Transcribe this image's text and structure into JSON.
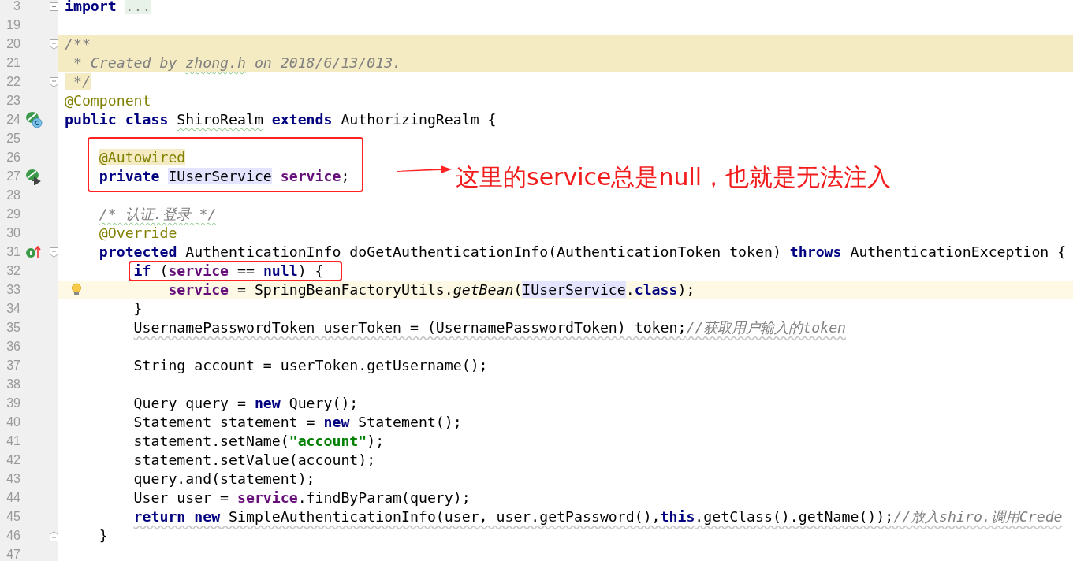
{
  "editor": {
    "lines": [
      {
        "number": "3",
        "fold": {
          "kind": "folded"
        },
        "tokens": [
          {
            "t": "import ",
            "kind": "keyword"
          },
          {
            "t": "...",
            "kind": "folded"
          }
        ]
      },
      {
        "number": "19"
      },
      {
        "number": "20",
        "fold": {
          "kind": "start"
        },
        "doc_block": true,
        "tokens": [
          {
            "t": "/**",
            "kind": "doc"
          }
        ]
      },
      {
        "number": "21",
        "doc_block": true,
        "tokens": [
          {
            "t": " * Created by ",
            "kind": "doc"
          },
          {
            "t": "zhong.h",
            "kind": "doc",
            "typo": true
          },
          {
            "t": " on 2018/6/13/013.",
            "kind": "doc"
          }
        ]
      },
      {
        "number": "22",
        "fold": {
          "kind": "start"
        },
        "tokens": [
          {
            "t": " */",
            "kind": "doc",
            "highlighted": true
          }
        ]
      },
      {
        "number": "23",
        "tokens": [
          {
            "t": "@Component",
            "kind": "annotation"
          }
        ]
      },
      {
        "number": "24",
        "gutter": {
          "kind": "bean_class"
        },
        "tokens": [
          {
            "t": "public class ",
            "kind": "keyword"
          },
          {
            "t": "ShiroRealm",
            "kind": "plain",
            "typo": true
          },
          {
            "t": " extends",
            "kind": "keyword"
          },
          {
            "t": " AuthorizingRealm {",
            "kind": "plain"
          }
        ],
        "children": [
          {
            "number": "25"
          },
          {
            "number": "26",
            "tokens": [
              {
                "t": "@Autowired",
                "kind": "annotation",
                "highlighted": true
              }
            ]
          },
          {
            "number": "27",
            "gutter": {
              "kind": "bean_inject"
            },
            "tokens": [
              {
                "t": "private ",
                "kind": "keyword"
              },
              {
                "t": "IUserService",
                "kind": "plain",
                "highlighted": true
              },
              {
                "t": " service",
                "kind": "field"
              },
              {
                "t": ";",
                "kind": "plain"
              }
            ]
          },
          {
            "number": "28"
          },
          {
            "number": "29",
            "tokens": [
              {
                "t": "/* 认证.登录 */",
                "kind": "comment",
                "typo": true
              }
            ]
          },
          {
            "number": "30",
            "tokens": [
              {
                "t": "@Override",
                "kind": "annotation"
              }
            ]
          },
          {
            "number": "31",
            "gutter": {
              "kind": "override"
            },
            "fold": {
              "kind": "start"
            },
            "tokens": [
              {
                "t": "protected",
                "kind": "keyword"
              },
              {
                "t": " AuthenticationInfo doGetAuthenticationInfo(AuthenticationToken token) ",
                "kind": "plain"
              },
              {
                "t": "throws",
                "kind": "keyword"
              },
              {
                "t": " AuthenticationException {",
                "kind": "plain"
              }
            ],
            "children": [
              {
                "number": "32",
                "outlined": true,
                "tokens": [
                  {
                    "t": "if",
                    "kind": "keyword"
                  },
                  {
                    "t": " (",
                    "kind": "plain"
                  },
                  {
                    "t": "service",
                    "kind": "field"
                  },
                  {
                    "t": " == ",
                    "kind": "plain"
                  },
                  {
                    "t": "null",
                    "kind": "keyword"
                  },
                  {
                    "t": ") {",
                    "kind": "plain"
                  }
                ],
                "children": [
                  {
                    "number": "33",
                    "caret_line": true,
                    "intention": true,
                    "tokens": [
                      {
                        "t": "service",
                        "kind": "field"
                      },
                      {
                        "t": " = SpringBeanFactoryUtils.",
                        "kind": "plain"
                      },
                      {
                        "t": "getBean",
                        "kind": "static"
                      },
                      {
                        "t": "(",
                        "kind": "plain"
                      },
                      {
                        "t": "IUserService",
                        "kind": "plain",
                        "highlighted": true
                      },
                      {
                        "t": ".",
                        "kind": "plain"
                      },
                      {
                        "t": "class",
                        "kind": "keyword"
                      },
                      {
                        "t": ");",
                        "kind": "plain"
                      }
                    ]
                  }
                ]
              },
              {
                "number": "34",
                "tokens": [
                  {
                    "t": "}",
                    "kind": "plain"
                  }
                ]
              },
              {
                "number": "35",
                "warning": true,
                "tokens": [
                  {
                    "t": "UsernamePasswordToken userToken = (UsernamePasswordToken) token;",
                    "kind": "plain"
                  },
                  {
                    "t": "//获取用户输入的token",
                    "kind": "comment"
                  }
                ]
              },
              {
                "number": "36"
              },
              {
                "number": "37",
                "tokens": [
                  {
                    "t": "String account = userToken.getUsername();",
                    "kind": "plain"
                  }
                ]
              },
              {
                "number": "38"
              },
              {
                "number": "39",
                "tokens": [
                  {
                    "t": "Query query = ",
                    "kind": "plain"
                  },
                  {
                    "t": "new",
                    "kind": "keyword"
                  },
                  {
                    "t": " Query();",
                    "kind": "plain"
                  }
                ]
              },
              {
                "number": "40",
                "tokens": [
                  {
                    "t": "Statement statement = ",
                    "kind": "plain"
                  },
                  {
                    "t": "new",
                    "kind": "keyword"
                  },
                  {
                    "t": " Statement();",
                    "kind": "plain"
                  }
                ]
              },
              {
                "number": "41",
                "tokens": [
                  {
                    "t": "statement.setName(",
                    "kind": "plain"
                  },
                  {
                    "t": "\"account\"",
                    "kind": "string"
                  },
                  {
                    "t": ");",
                    "kind": "plain"
                  }
                ]
              },
              {
                "number": "42",
                "tokens": [
                  {
                    "t": "statement.setValue(account);",
                    "kind": "plain"
                  }
                ]
              },
              {
                "number": "43",
                "tokens": [
                  {
                    "t": "query.and(statement);",
                    "kind": "plain"
                  }
                ]
              },
              {
                "number": "44",
                "tokens": [
                  {
                    "t": "User user = ",
                    "kind": "plain"
                  },
                  {
                    "t": "service",
                    "kind": "field"
                  },
                  {
                    "t": ".findByParam(query);",
                    "kind": "plain"
                  }
                ]
              },
              {
                "number": "45",
                "warning": true,
                "tokens": [
                  {
                    "t": "return new",
                    "kind": "keyword"
                  },
                  {
                    "t": " SimpleAuthenticationInfo(user, user.getPassword(),",
                    "kind": "plain"
                  },
                  {
                    "t": "this",
                    "kind": "keyword"
                  },
                  {
                    "t": ".getClass().getName());",
                    "kind": "plain"
                  },
                  {
                    "t": "//放入shiro.调用Crede",
                    "kind": "comment"
                  }
                ]
              }
            ]
          },
          {
            "number": "46",
            "fold": {
              "kind": "end"
            },
            "tokens": [
              {
                "t": "}",
                "kind": "plain"
              }
            ]
          }
        ]
      },
      {
        "number": "47"
      }
    ]
  },
  "annotations": [
    {
      "kind": "box"
    },
    {
      "kind": "arrow_note",
      "note": "这里的service总是null，也就是无法注入"
    }
  ]
}
